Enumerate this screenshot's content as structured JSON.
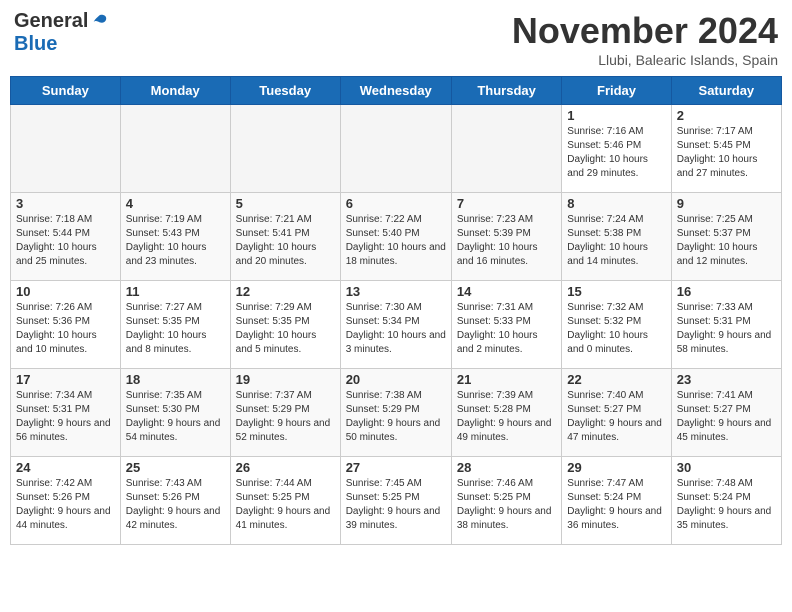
{
  "header": {
    "logo_general": "General",
    "logo_blue": "Blue",
    "title": "November 2024",
    "location": "Llubi, Balearic Islands, Spain"
  },
  "days_of_week": [
    "Sunday",
    "Monday",
    "Tuesday",
    "Wednesday",
    "Thursday",
    "Friday",
    "Saturday"
  ],
  "weeks": [
    [
      {
        "day": "",
        "info": ""
      },
      {
        "day": "",
        "info": ""
      },
      {
        "day": "",
        "info": ""
      },
      {
        "day": "",
        "info": ""
      },
      {
        "day": "",
        "info": ""
      },
      {
        "day": "1",
        "info": "Sunrise: 7:16 AM\nSunset: 5:46 PM\nDaylight: 10 hours and 29 minutes."
      },
      {
        "day": "2",
        "info": "Sunrise: 7:17 AM\nSunset: 5:45 PM\nDaylight: 10 hours and 27 minutes."
      }
    ],
    [
      {
        "day": "3",
        "info": "Sunrise: 7:18 AM\nSunset: 5:44 PM\nDaylight: 10 hours and 25 minutes."
      },
      {
        "day": "4",
        "info": "Sunrise: 7:19 AM\nSunset: 5:43 PM\nDaylight: 10 hours and 23 minutes."
      },
      {
        "day": "5",
        "info": "Sunrise: 7:21 AM\nSunset: 5:41 PM\nDaylight: 10 hours and 20 minutes."
      },
      {
        "day": "6",
        "info": "Sunrise: 7:22 AM\nSunset: 5:40 PM\nDaylight: 10 hours and 18 minutes."
      },
      {
        "day": "7",
        "info": "Sunrise: 7:23 AM\nSunset: 5:39 PM\nDaylight: 10 hours and 16 minutes."
      },
      {
        "day": "8",
        "info": "Sunrise: 7:24 AM\nSunset: 5:38 PM\nDaylight: 10 hours and 14 minutes."
      },
      {
        "day": "9",
        "info": "Sunrise: 7:25 AM\nSunset: 5:37 PM\nDaylight: 10 hours and 12 minutes."
      }
    ],
    [
      {
        "day": "10",
        "info": "Sunrise: 7:26 AM\nSunset: 5:36 PM\nDaylight: 10 hours and 10 minutes."
      },
      {
        "day": "11",
        "info": "Sunrise: 7:27 AM\nSunset: 5:35 PM\nDaylight: 10 hours and 8 minutes."
      },
      {
        "day": "12",
        "info": "Sunrise: 7:29 AM\nSunset: 5:35 PM\nDaylight: 10 hours and 5 minutes."
      },
      {
        "day": "13",
        "info": "Sunrise: 7:30 AM\nSunset: 5:34 PM\nDaylight: 10 hours and 3 minutes."
      },
      {
        "day": "14",
        "info": "Sunrise: 7:31 AM\nSunset: 5:33 PM\nDaylight: 10 hours and 2 minutes."
      },
      {
        "day": "15",
        "info": "Sunrise: 7:32 AM\nSunset: 5:32 PM\nDaylight: 10 hours and 0 minutes."
      },
      {
        "day": "16",
        "info": "Sunrise: 7:33 AM\nSunset: 5:31 PM\nDaylight: 9 hours and 58 minutes."
      }
    ],
    [
      {
        "day": "17",
        "info": "Sunrise: 7:34 AM\nSunset: 5:31 PM\nDaylight: 9 hours and 56 minutes."
      },
      {
        "day": "18",
        "info": "Sunrise: 7:35 AM\nSunset: 5:30 PM\nDaylight: 9 hours and 54 minutes."
      },
      {
        "day": "19",
        "info": "Sunrise: 7:37 AM\nSunset: 5:29 PM\nDaylight: 9 hours and 52 minutes."
      },
      {
        "day": "20",
        "info": "Sunrise: 7:38 AM\nSunset: 5:29 PM\nDaylight: 9 hours and 50 minutes."
      },
      {
        "day": "21",
        "info": "Sunrise: 7:39 AM\nSunset: 5:28 PM\nDaylight: 9 hours and 49 minutes."
      },
      {
        "day": "22",
        "info": "Sunrise: 7:40 AM\nSunset: 5:27 PM\nDaylight: 9 hours and 47 minutes."
      },
      {
        "day": "23",
        "info": "Sunrise: 7:41 AM\nSunset: 5:27 PM\nDaylight: 9 hours and 45 minutes."
      }
    ],
    [
      {
        "day": "24",
        "info": "Sunrise: 7:42 AM\nSunset: 5:26 PM\nDaylight: 9 hours and 44 minutes."
      },
      {
        "day": "25",
        "info": "Sunrise: 7:43 AM\nSunset: 5:26 PM\nDaylight: 9 hours and 42 minutes."
      },
      {
        "day": "26",
        "info": "Sunrise: 7:44 AM\nSunset: 5:25 PM\nDaylight: 9 hours and 41 minutes."
      },
      {
        "day": "27",
        "info": "Sunrise: 7:45 AM\nSunset: 5:25 PM\nDaylight: 9 hours and 39 minutes."
      },
      {
        "day": "28",
        "info": "Sunrise: 7:46 AM\nSunset: 5:25 PM\nDaylight: 9 hours and 38 minutes."
      },
      {
        "day": "29",
        "info": "Sunrise: 7:47 AM\nSunset: 5:24 PM\nDaylight: 9 hours and 36 minutes."
      },
      {
        "day": "30",
        "info": "Sunrise: 7:48 AM\nSunset: 5:24 PM\nDaylight: 9 hours and 35 minutes."
      }
    ]
  ]
}
